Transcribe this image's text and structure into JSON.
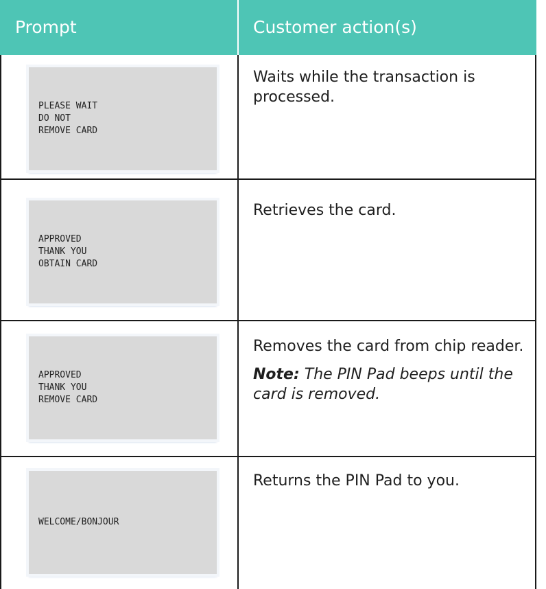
{
  "header": {
    "col_prompt": "Prompt",
    "col_action": "Customer action(s)"
  },
  "rows": [
    {
      "screen_lines": "PLEASE WAIT\nDO NOT\nREMOVE CARD",
      "action": "Waits while the transaction is processed."
    },
    {
      "screen_lines": "APPROVED\nTHANK YOU\nOBTAIN CARD",
      "action": "Retrieves the card."
    },
    {
      "screen_lines": "APPROVED\nTHANK YOU\nREMOVE CARD",
      "action": "Removes the card from chip reader.",
      "note_label": "Note:",
      "note_text": " The PIN Pad beeps until the card is removed."
    },
    {
      "screen_lines": "WELCOME/BONJOUR",
      "action": "Returns the PIN Pad to you."
    }
  ]
}
